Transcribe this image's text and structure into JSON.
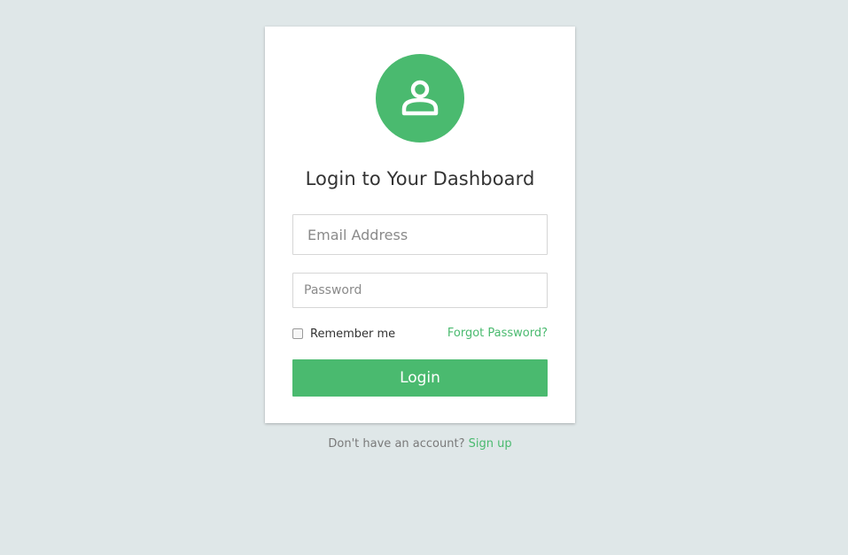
{
  "login_card": {
    "avatar_icon": "user-icon",
    "title": "Login to Your Dashboard",
    "email_placeholder": "Email Address",
    "password_placeholder": "Password",
    "remember_label": "Remember me",
    "forgot_link": "Forgot Password?",
    "login_button": "Login"
  },
  "footer": {
    "signup_prompt": "Don't have an account?",
    "signup_link": "Sign up"
  },
  "colors": {
    "background": "#dfe7e8",
    "accent": "#4aba6f",
    "card": "#ffffff"
  }
}
